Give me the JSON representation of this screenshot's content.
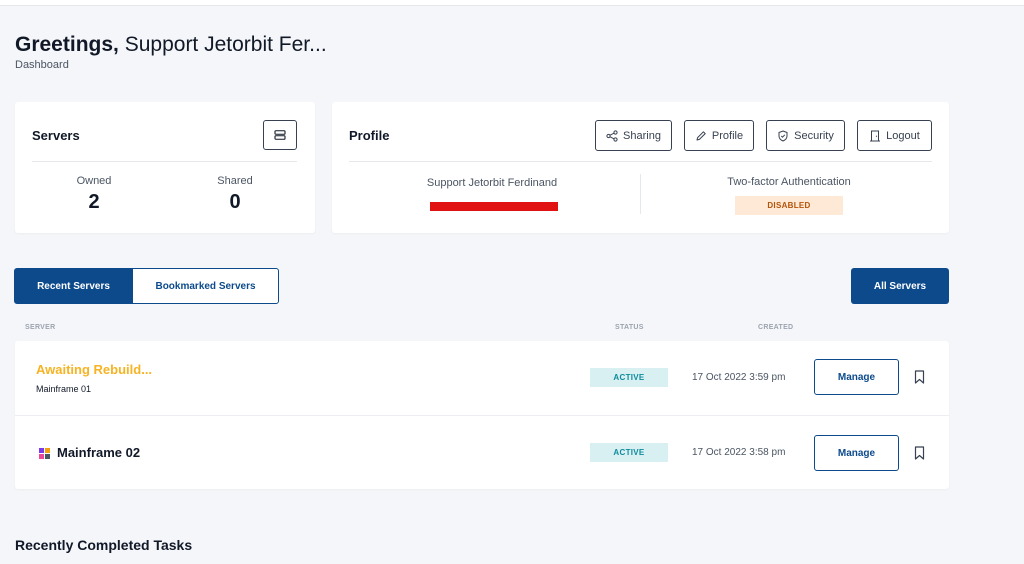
{
  "header": {
    "greeting_prefix": "Greetings,",
    "user_name": "Support Jetorbit Fer...",
    "breadcrumb": "Dashboard"
  },
  "servers_card": {
    "title": "Servers",
    "owned_label": "Owned",
    "owned_value": "2",
    "shared_label": "Shared",
    "shared_value": "0",
    "icon": "server-icon"
  },
  "profile_card": {
    "title": "Profile",
    "buttons": [
      {
        "label": "Sharing",
        "icon": "share-icon"
      },
      {
        "label": "Profile",
        "icon": "pencil-icon"
      },
      {
        "label": "Security",
        "icon": "shield-icon"
      },
      {
        "label": "Logout",
        "icon": "door-icon"
      }
    ],
    "full_name": "Support Jetorbit Ferdinand",
    "tfa_label": "Two-factor Authentication",
    "tfa_status": "DISABLED"
  },
  "tabs": {
    "recent": "Recent Servers",
    "bookmarked": "Bookmarked Servers",
    "all_servers": "All Servers"
  },
  "table": {
    "headers": {
      "server": "SERVER",
      "status": "STATUS",
      "created": "CREATED"
    },
    "rows": [
      {
        "title": "Awaiting Rebuild...",
        "subtitle": "Mainframe 01",
        "status": "ACTIVE",
        "created": "17 Oct 2022 3:59 pm",
        "action": "Manage"
      },
      {
        "title": "Mainframe 02",
        "status": "ACTIVE",
        "created": "17 Oct 2022 3:58 pm",
        "action": "Manage"
      }
    ]
  },
  "tasks": {
    "title": "Recently Completed Tasks"
  },
  "colors": {
    "primary": "#0c4a8c",
    "warning": "#f6b323",
    "active_bg": "#d9f0f3",
    "active_text": "#0e8a9b",
    "disabled_bg": "#fde9d6",
    "disabled_text": "#b45309",
    "background": "#f4f6f9"
  }
}
